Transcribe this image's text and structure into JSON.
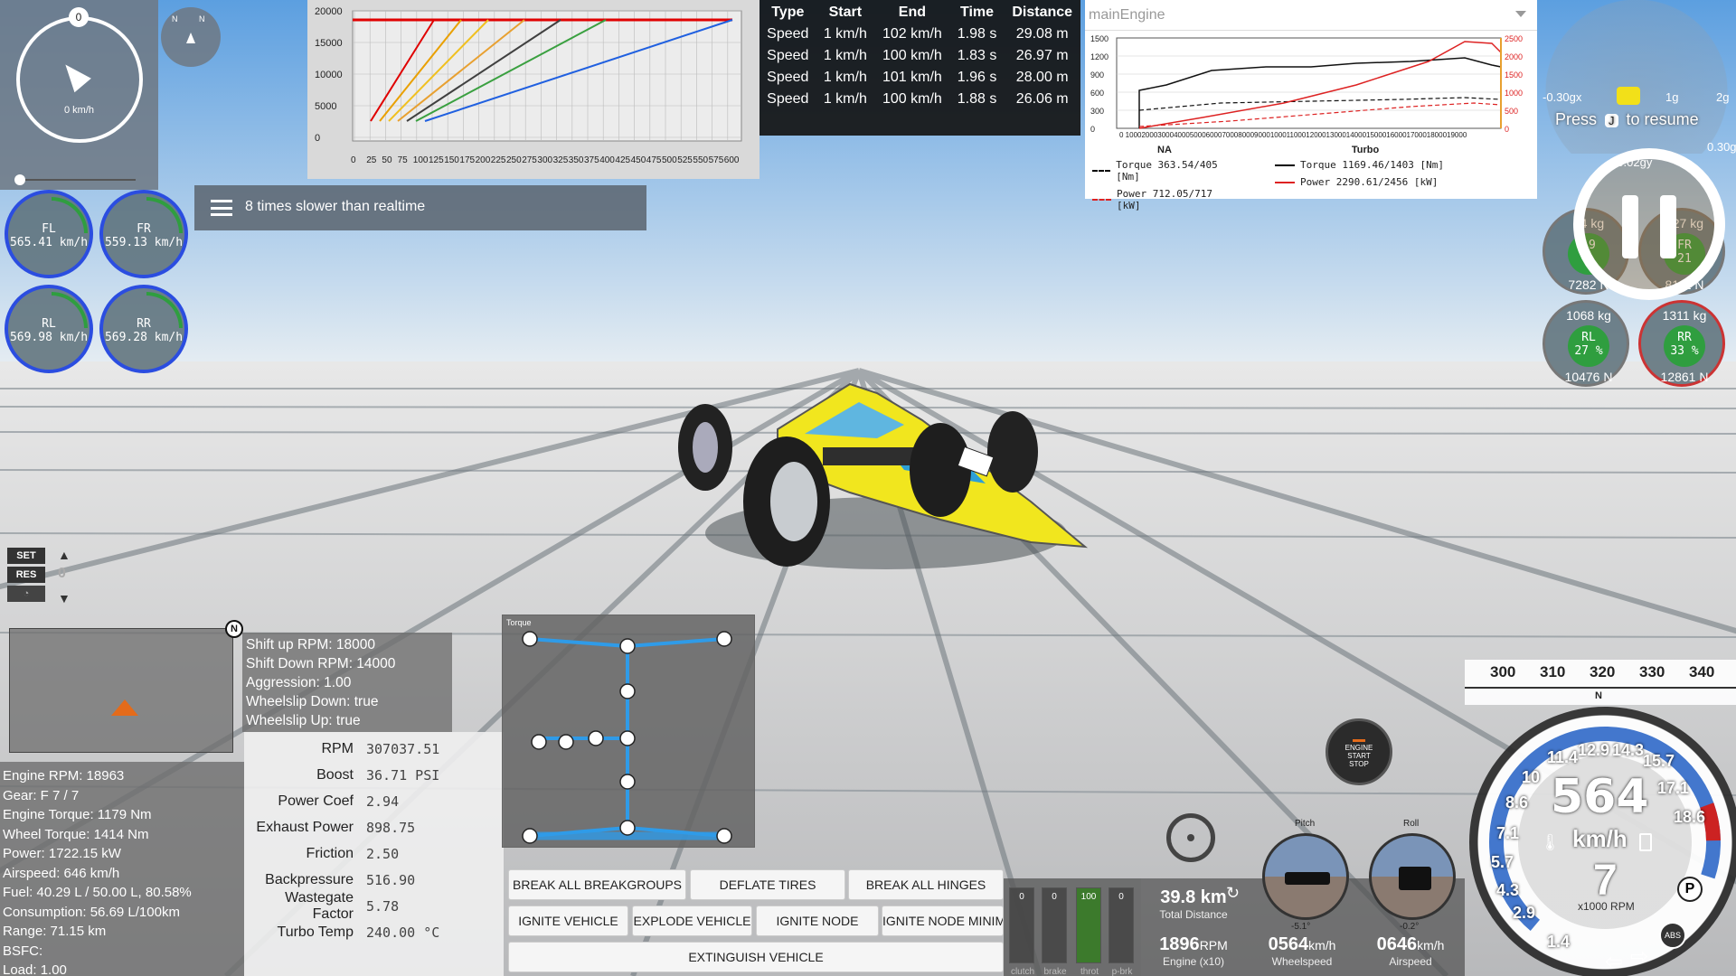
{
  "compass": {
    "north": "0",
    "speed": "0 km/h"
  },
  "mini_compass": {
    "n": "N"
  },
  "wheels": [
    {
      "id": "FL",
      "speed": "565.41 km/h"
    },
    {
      "id": "FR",
      "speed": "559.13 km/h"
    },
    {
      "id": "RL",
      "speed": "569.98 km/h"
    },
    {
      "id": "RR",
      "speed": "569.28 km/h"
    }
  ],
  "shift_chart": {
    "y_ticks": [
      "20000",
      "15000",
      "10000",
      "5000",
      "0"
    ],
    "x_ticks": [
      "0",
      "25",
      "50",
      "75",
      "100",
      "125",
      "150",
      "175",
      "200",
      "225",
      "250",
      "275",
      "300",
      "325",
      "350",
      "375",
      "400",
      "425",
      "450",
      "475",
      "500",
      "525",
      "550",
      "575",
      "600"
    ],
    "colors": [
      "#e00000",
      "#e9a000",
      "#f0c020",
      "#e8a030",
      "#404040",
      "#3aa040",
      "#2060e0"
    ]
  },
  "results": {
    "headers": [
      "Type",
      "Start",
      "End",
      "Time",
      "Distance"
    ],
    "rows": [
      [
        "Speed",
        "1 km/h",
        "102 km/h",
        "1.98 s",
        "29.08 m"
      ],
      [
        "Speed",
        "1 km/h",
        "100 km/h",
        "1.83 s",
        "26.97 m"
      ],
      [
        "Speed",
        "1 km/h",
        "101 km/h",
        "1.96 s",
        "28.00 m"
      ],
      [
        "Speed",
        "1 km/h",
        "100 km/h",
        "1.88 s",
        "26.06 m"
      ]
    ]
  },
  "engine_graph": {
    "selector": "mainEngine",
    "y_left": [
      "1500",
      "1200",
      "900",
      "600",
      "300",
      "0"
    ],
    "y_right": [
      "2500",
      "2000",
      "1500",
      "1000",
      "500",
      "0"
    ],
    "x_ticks": "0 1000200030004000500060007000800090001000110001200013000140001500016000170001800019000",
    "na_label": "NA",
    "turbo_label": "Turbo",
    "na_torque": "Torque 363.54/405 [Nm]",
    "na_power": "Power  712.05/717 [kW]",
    "turbo_torque": "Torque 1169.46/1403 [Nm]",
    "turbo_power": "Power  2290.61/2456 [kW]"
  },
  "gmeter": {
    "left": "-0.30gx",
    "g1": "1g",
    "g2": "2g",
    "g_right": "0.30g",
    "g_lower": "-0.02gy"
  },
  "resume": {
    "press": "Press",
    "key": "J",
    "text": "to resume"
  },
  "load": [
    {
      "id": "FL",
      "top": "74 kg",
      "pct": "19",
      "bottom": "7282 N"
    },
    {
      "id": "FR",
      "top": "827 kg",
      "pct": "21",
      "bottom": "8111 N"
    },
    {
      "id": "RL",
      "top": "1068 kg",
      "pct": "27 %",
      "bottom": "10476 N"
    },
    {
      "id": "RR",
      "top": "1311 kg",
      "pct": "33 %",
      "bottom": "12861 N"
    }
  ],
  "message": "8 times slower than realtime",
  "cruise": {
    "set": "SET",
    "res": "RES",
    "value": "0"
  },
  "minimap": {
    "n": "N"
  },
  "shift_info": [
    "Shift up RPM: 18000",
    "Shift Down RPM: 14000",
    "Aggression: 1.00",
    "Wheelslip Down: true",
    "Wheelslip Up: true"
  ],
  "vehicle_info": [
    "Engine RPM: 18963",
    "Gear: F 7 / 7",
    "Engine Torque: 1179 Nm",
    "Wheel Torque: 1414 Nm",
    "Power: 1722.15 kW",
    "Airspeed: 646 km/h",
    "Fuel: 40.29 L / 50.00 L, 80.58%",
    "Consumption: 56.69 L/100km",
    "Range: 71.15 km",
    "BSFC:",
    "Load: 1.00"
  ],
  "turbo": [
    {
      "k": "RPM",
      "v": "307037.51"
    },
    {
      "k": "Boost",
      "v": "36.71 PSI"
    },
    {
      "k": "Power Coef",
      "v": "2.94"
    },
    {
      "k": "Exhaust Power",
      "v": "898.75"
    },
    {
      "k": "Friction",
      "v": "2.50"
    },
    {
      "k": "Backpressure",
      "v": "516.90"
    },
    {
      "k": "Wastegate Factor",
      "v": "5.78"
    },
    {
      "k": "Turbo Temp",
      "v": "240.00 °C"
    }
  ],
  "drivetrain": {
    "label": "Torque"
  },
  "buttons": {
    "break_breakgroups": "BREAK ALL BREAKGROUPS",
    "deflate_tires": "DEFLATE TIRES",
    "break_hinges": "BREAK ALL HINGES",
    "ignite_vehicle": "IGNITE VEHICLE",
    "explode_vehicle": "EXPLODE VEHICLE",
    "ignite_node": "IGNITE NODE",
    "ignite_node_min": "IGNITE NODE MINIMALLY",
    "extinguish": "EXTINGUISH VEHICLE"
  },
  "pedals": [
    {
      "label": "clutch",
      "value": "0",
      "level": 0
    },
    {
      "label": "brake",
      "value": "0",
      "level": 0
    },
    {
      "label": "throt",
      "value": "100",
      "level": 1
    },
    {
      "label": "p-brk",
      "value": "0",
      "level": 0
    }
  ],
  "stats": {
    "distance": "39.8 km",
    "distance_label": "Total Distance",
    "rpm": "1896",
    "rpm_unit": "RPM",
    "rpm_label": "Engine (x10)",
    "wheelspeed": "0564",
    "wheelspeed_unit": "km/h",
    "wheelspeed_label": "Wheelspeed",
    "airspeed": "0646",
    "airspeed_unit": "km/h",
    "airspeed_label": "Airspeed"
  },
  "attitude": {
    "pitch": "Pitch",
    "pitch_val": "-5.1°",
    "roll": "Roll",
    "roll_val": "-0.2°"
  },
  "engine_button": {
    "l1": "ENGINE",
    "l2": "START",
    "l3": "STOP"
  },
  "tape": {
    "ticks": [
      "300",
      "310",
      "320",
      "330",
      "340"
    ],
    "n": "N"
  },
  "speedo": {
    "speed": "564",
    "unit": "km/h",
    "gear": "7",
    "rpm_label": "x1000 RPM",
    "ticks": [
      "1.4",
      "2.9",
      "4.3",
      "5.7",
      "7.1",
      "8.6",
      "10",
      "11.4",
      "12.9",
      "14.3",
      "15.7",
      "17.1",
      "18.6"
    ],
    "abs": "ABS",
    "p": "P"
  }
}
